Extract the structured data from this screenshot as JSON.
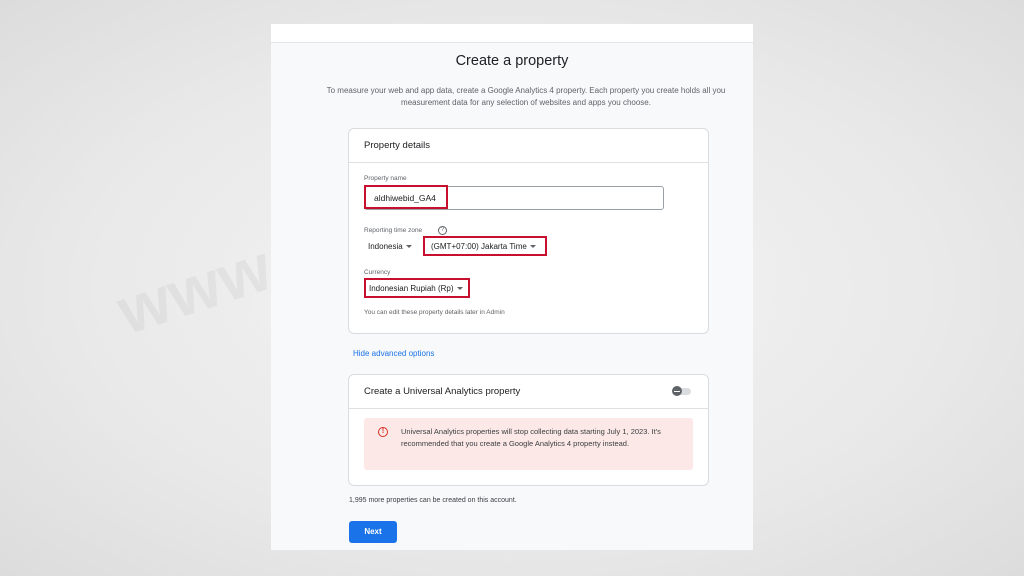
{
  "page": {
    "title": "Create a property",
    "subtitle_line1": "To measure your web and app data, create a Google Analytics 4 property. Each property you create holds all you",
    "subtitle_line2": "measurement data for any selection of websites and apps you choose."
  },
  "property_details": {
    "header": "Property details",
    "name_label": "Property name",
    "name_value": "aldhiwebid_GA4",
    "timezone_label": "Reporting time zone",
    "timezone_help_icon": "help-circle-icon",
    "country_value": "Indonesia",
    "timezone_value": "(GMT+07:00) Jakarta Time",
    "currency_label": "Currency",
    "currency_value": "Indonesian Rupiah (Rp)",
    "hint": "You can edit these property details later in Admin"
  },
  "advanced_link": "Hide advanced options",
  "universal_analytics": {
    "header": "Create a Universal Analytics property",
    "toggle_state": "off",
    "alert_icon": "error-outline-icon",
    "alert_text": "Universal Analytics properties will stop collecting data starting July 1, 2023. It's recommended that you create a Google Analytics 4 property instead."
  },
  "remaining_text": "1,995 more properties can be created on this account.",
  "next_label": "Next",
  "watermark": "www.aldhifajar.com",
  "colors": {
    "highlight_box": "#c8102e",
    "primary_button": "#1a73e8",
    "link": "#1a73e8",
    "alert_bg": "#fce8e6",
    "alert_icon": "#d93025"
  }
}
